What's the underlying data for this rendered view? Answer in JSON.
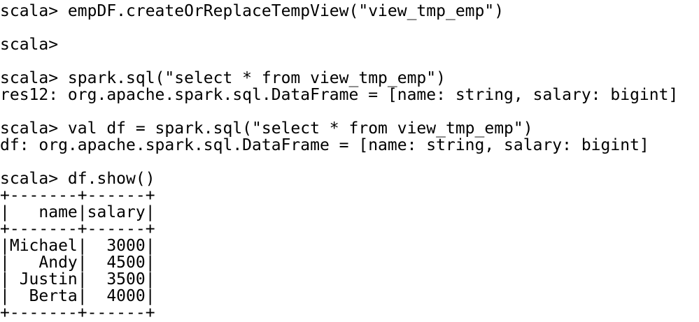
{
  "terminal": {
    "lines": [
      "scala> empDF.createOrReplaceTempView(\"view_tmp_emp\")",
      "",
      "scala>",
      "",
      "scala> spark.sql(\"select * from view_tmp_emp\")",
      "res12: org.apache.spark.sql.DataFrame = [name: string, salary: bigint]",
      "",
      "scala> val df = spark.sql(\"select * from view_tmp_emp\")",
      "df: org.apache.spark.sql.DataFrame = [name: string, salary: bigint]",
      "",
      "scala> df.show()",
      "+-------+------+",
      "|   name|salary|",
      "+-------+------+",
      "|Michael|  3000|",
      "|   Andy|  4500|",
      "| Justin|  3500|",
      "|  Berta|  4000|",
      "+-------+------+"
    ]
  }
}
